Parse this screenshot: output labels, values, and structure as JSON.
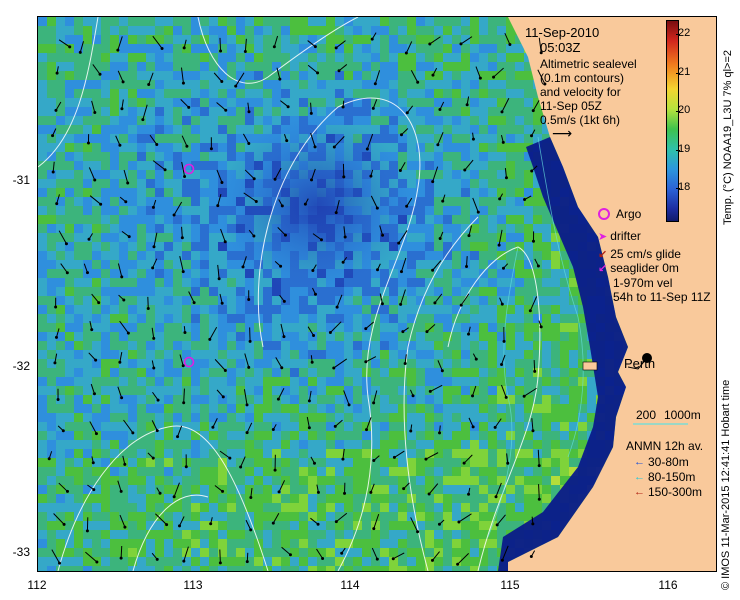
{
  "map": {
    "x_ticks": [
      "112",
      "113",
      "114",
      "115",
      "116"
    ],
    "y_ticks": [
      "-31",
      "-32",
      "-33"
    ],
    "land_color": "#f9c99b",
    "ocean_deep_color": "#0a1a8a",
    "contour_color": "#ffffff"
  },
  "info": {
    "date": "11-Sep-2010",
    "time": "05:03Z",
    "line1": "Altimetric sealevel",
    "line2": "(0.1m contours)",
    "line3": "and velocity for",
    "line4": "11-Sep 05Z",
    "line5": "0.5m/s (1kt 6h)"
  },
  "colorbar": {
    "title": "Temp. (°C) NOAA19_L3U 7% ql>=2",
    "ticks": [
      "22",
      "21",
      "20",
      "19",
      "18"
    ]
  },
  "legend": {
    "argo": "Argo",
    "drifter": "drifter",
    "glide": "25 cm/s glide",
    "seaglider": "seaglider 0m",
    "vel1": "1-970m vel",
    "vel2": "54h to 11-Sep 11Z",
    "city": "Perth",
    "depth_200": "200",
    "depth_1000": "1000m",
    "anmn_title": "ANMN 12h av.",
    "anmn1": "30-80m",
    "anmn2": "80-150m",
    "anmn3": "150-300m",
    "anmn_colors": [
      "#1a4fd6",
      "#20c8d8",
      "#b02010"
    ],
    "argo_color": "#e020e0",
    "drifter_color": "#e020e0"
  },
  "credit": "© IMOS 11-Mar-2015 12:41:41 Hobart time"
}
